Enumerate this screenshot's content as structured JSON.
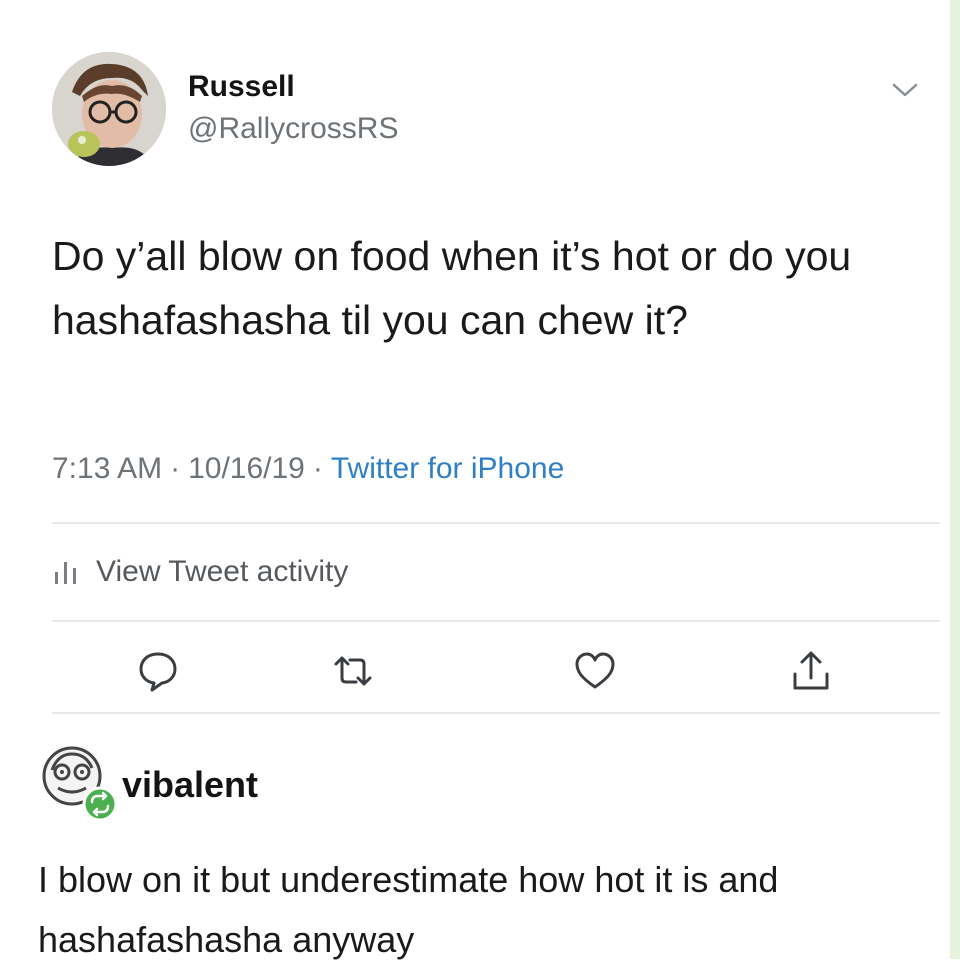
{
  "tweet": {
    "author_name": "Russell",
    "author_handle": "@RallycrossRS",
    "avatar_icon": "profile-photo-avatar",
    "text": "Do y’all blow on food when it’s hot or do you hashafashasha til you can chew it?",
    "time": "7:13 AM",
    "date": "10/16/19",
    "separator": "·",
    "source": "Twitter for iPhone",
    "activity_label": "View Tweet activity",
    "actions": [
      "reply-icon",
      "retweet-icon",
      "like-icon",
      "share-icon"
    ]
  },
  "reply": {
    "author_name": "vibalent",
    "avatar_icon": "cartoon-face-avatar",
    "badge_icon": "reblog-icon",
    "text": "I blow on it but underestimate how hot it is and hashafashasha anyway"
  },
  "colors": {
    "link_blue": "#2f7fc4",
    "secondary_gray": "#6e7378",
    "badge_green": "#4caf50"
  }
}
